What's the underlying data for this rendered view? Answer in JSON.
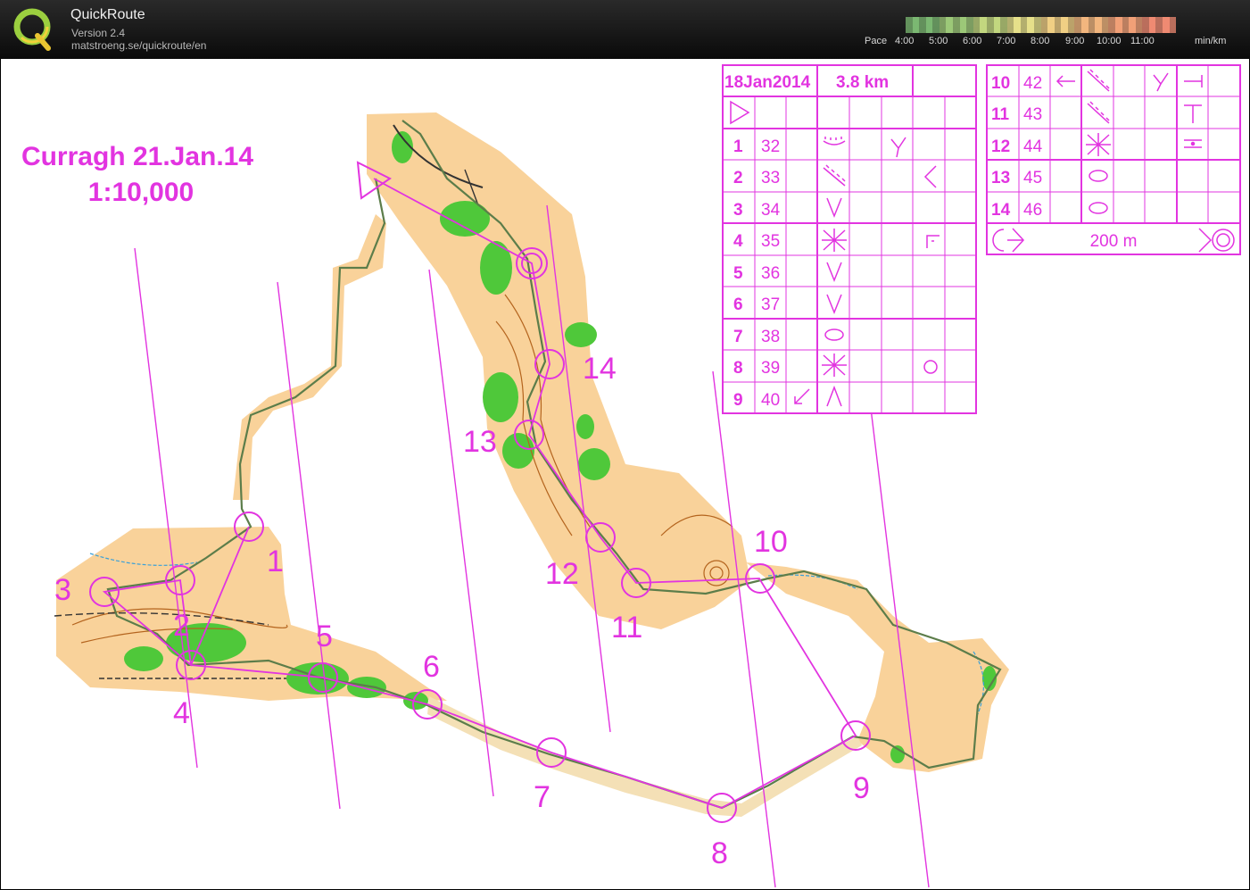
{
  "app": {
    "name": "QuickRoute",
    "version": "Version 2.4",
    "url": "matstroeng.se/quickroute/en"
  },
  "pace_scale": {
    "label": "Pace",
    "ticks": [
      "4:00",
      "5:00",
      "6:00",
      "7:00",
      "8:00",
      "9:00",
      "10:00",
      "11:00"
    ],
    "unit": "min/km",
    "colors": [
      "#7bb872",
      "#9cc878",
      "#c2d77f",
      "#e6e08a",
      "#f0cf84",
      "#f2b67e",
      "#f1a077",
      "#ef8a72"
    ]
  },
  "map": {
    "title_line1": "Curragh 21.Jan.14",
    "title_line2": "1:10,000",
    "accent_color": "#e234e0",
    "controls": [
      {
        "label": "1"
      },
      {
        "label": "2"
      },
      {
        "label": "3"
      },
      {
        "label": "4"
      },
      {
        "label": "5"
      },
      {
        "label": "6"
      },
      {
        "label": "7"
      },
      {
        "label": "8"
      },
      {
        "label": "9"
      },
      {
        "label": "10"
      },
      {
        "label": "11"
      },
      {
        "label": "12"
      },
      {
        "label": "13"
      },
      {
        "label": "14"
      }
    ]
  },
  "description_sheet": {
    "date": "18Jan2014",
    "distance": "3.8 km",
    "rows_left": [
      {
        "num": "1",
        "code": "32"
      },
      {
        "num": "2",
        "code": "33"
      },
      {
        "num": "3",
        "code": "34"
      },
      {
        "num": "4",
        "code": "35"
      },
      {
        "num": "5",
        "code": "36"
      },
      {
        "num": "6",
        "code": "37"
      },
      {
        "num": "7",
        "code": "38"
      },
      {
        "num": "8",
        "code": "39"
      },
      {
        "num": "9",
        "code": "40"
      }
    ],
    "rows_right": [
      {
        "num": "10",
        "code": "42"
      },
      {
        "num": "11",
        "code": "43"
      },
      {
        "num": "12",
        "code": "44"
      },
      {
        "num": "13",
        "code": "45"
      },
      {
        "num": "14",
        "code": "46"
      }
    ],
    "finish_distance": "200 m"
  }
}
